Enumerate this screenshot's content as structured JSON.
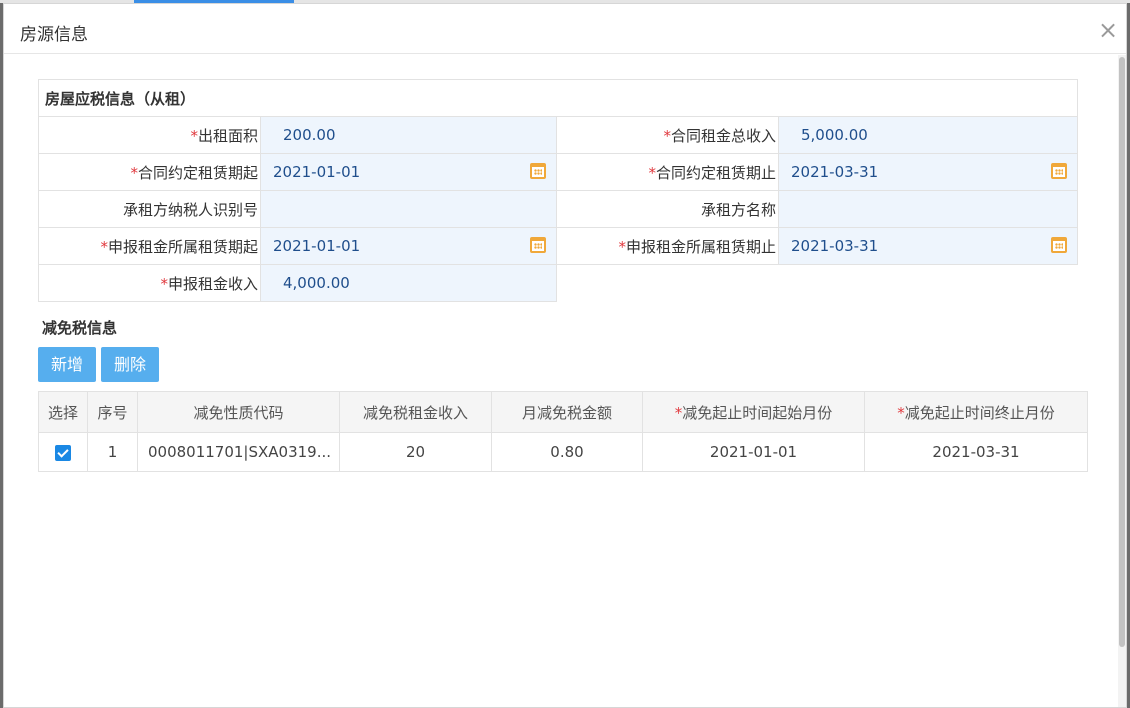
{
  "dialog": {
    "title": "房源信息",
    "close_glyph": "×"
  },
  "rental_info": {
    "section_title": "房屋应税信息（从租）",
    "required_mark": "*",
    "rows": [
      {
        "label1": "出租面积",
        "required1": true,
        "value1": "200.00",
        "label2": "合同租金总收入",
        "required2": true,
        "value2": "5,000.00"
      },
      {
        "label1": "合同约定租赁期起",
        "required1": true,
        "value1": "2021-01-01",
        "label2": "合同约定租赁期止",
        "required2": true,
        "value2": "2021-03-31"
      },
      {
        "label1": "承租方纳税人识别号",
        "required1": false,
        "value1": "",
        "label2": "承租方名称",
        "required2": false,
        "value2": ""
      },
      {
        "label1": "申报租金所属租赁期起",
        "required1": true,
        "value1": "2021-01-01",
        "label2": "申报租金所属租赁期止",
        "required2": true,
        "value2": "2021-03-31"
      },
      {
        "label1": "申报租金收入",
        "required1": true,
        "value1": "4,000.00"
      }
    ]
  },
  "relief": {
    "section_title": "减免税信息",
    "add_label": "新增",
    "delete_label": "删除",
    "columns": [
      "选择",
      "序号",
      "减免性质代码",
      "减免税租金收入",
      "月减免税金额",
      "减免起止时间起始月份",
      "减免起止时间终止月份"
    ],
    "rows": [
      {
        "checked": true,
        "index": "1",
        "code": "0008011701|SXA0319...",
        "income": "20",
        "monthly_amount": "0.80",
        "start": "2021-01-01",
        "end": "2021-03-31"
      }
    ]
  },
  "colors": {
    "accent": "#56aeee",
    "required": "#e0393e",
    "value_bg": "#eef5fd",
    "calendar_icon": "#f0a83a"
  }
}
